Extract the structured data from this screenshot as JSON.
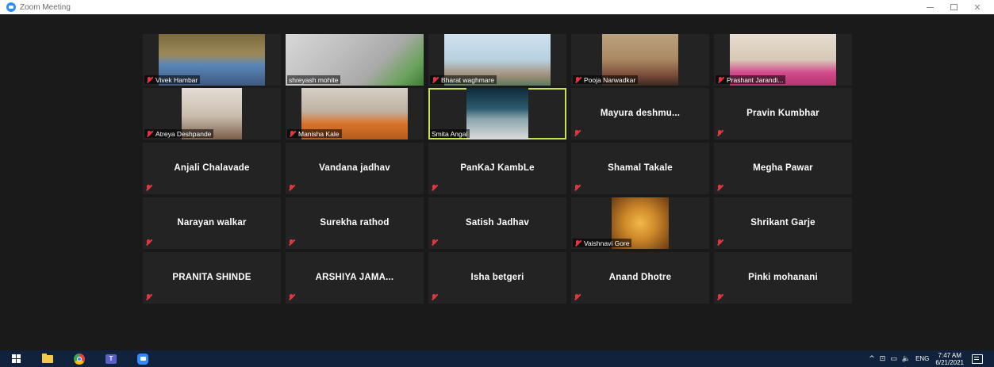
{
  "window": {
    "title": "Zoom Meeting"
  },
  "participants": [
    {
      "name": "Vivek Hambar",
      "video": true,
      "muted": true
    },
    {
      "name": "shreyash mohite",
      "video": true,
      "muted": false
    },
    {
      "name": "Bharat waghmare",
      "video": true,
      "muted": true
    },
    {
      "name": "Pooja Narwadkar",
      "video": true,
      "muted": true
    },
    {
      "name": "Prashant Jarandi...",
      "video": true,
      "muted": true
    },
    {
      "name": "Atreya Deshpande",
      "video": true,
      "muted": true
    },
    {
      "name": "Manisha Kale",
      "video": true,
      "muted": true
    },
    {
      "name": "Smita Angal",
      "video": true,
      "muted": false,
      "active_speaker": true
    },
    {
      "name": "Mayura  deshmu...",
      "video": false,
      "muted": true
    },
    {
      "name": "Pravin Kumbhar",
      "video": false,
      "muted": true
    },
    {
      "name": "Anjali Chalavade",
      "video": false,
      "muted": true
    },
    {
      "name": "Vandana jadhav",
      "video": false,
      "muted": true
    },
    {
      "name": "PanKaJ KambLe",
      "video": false,
      "muted": true
    },
    {
      "name": "Shamal Takale",
      "video": false,
      "muted": true
    },
    {
      "name": "Megha Pawar",
      "video": false,
      "muted": true
    },
    {
      "name": "Narayan walkar",
      "video": false,
      "muted": true
    },
    {
      "name": "Surekha rathod",
      "video": false,
      "muted": true
    },
    {
      "name": "Satish Jadhav",
      "video": false,
      "muted": true
    },
    {
      "name": "Vaishnavi Gore",
      "video": true,
      "muted": true
    },
    {
      "name": "Shrikant Garje",
      "video": false,
      "muted": true
    },
    {
      "name": "PRANITA SHINDE",
      "video": false,
      "muted": true
    },
    {
      "name": "ARSHIYA JAMA...",
      "video": false,
      "muted": true
    },
    {
      "name": "Isha betgeri",
      "video": false,
      "muted": true
    },
    {
      "name": "Anand Dhotre",
      "video": false,
      "muted": true
    },
    {
      "name": "Pinki mohanani",
      "video": false,
      "muted": true
    }
  ],
  "colors": {
    "active_speaker_border": "#c6e34a",
    "muted_icon": "#e0383e",
    "tile_bg": "#232323",
    "meeting_bg": "#1a1a1a",
    "taskbar_bg": "#10223c"
  },
  "taskbar": {
    "apps": [
      "windows-start-icon",
      "file-explorer-icon",
      "chrome-icon",
      "teams-icon",
      "zoom-icon"
    ],
    "tray": {
      "language": "ENG",
      "time": "7:47 AM",
      "date": "6/21/2021"
    }
  }
}
